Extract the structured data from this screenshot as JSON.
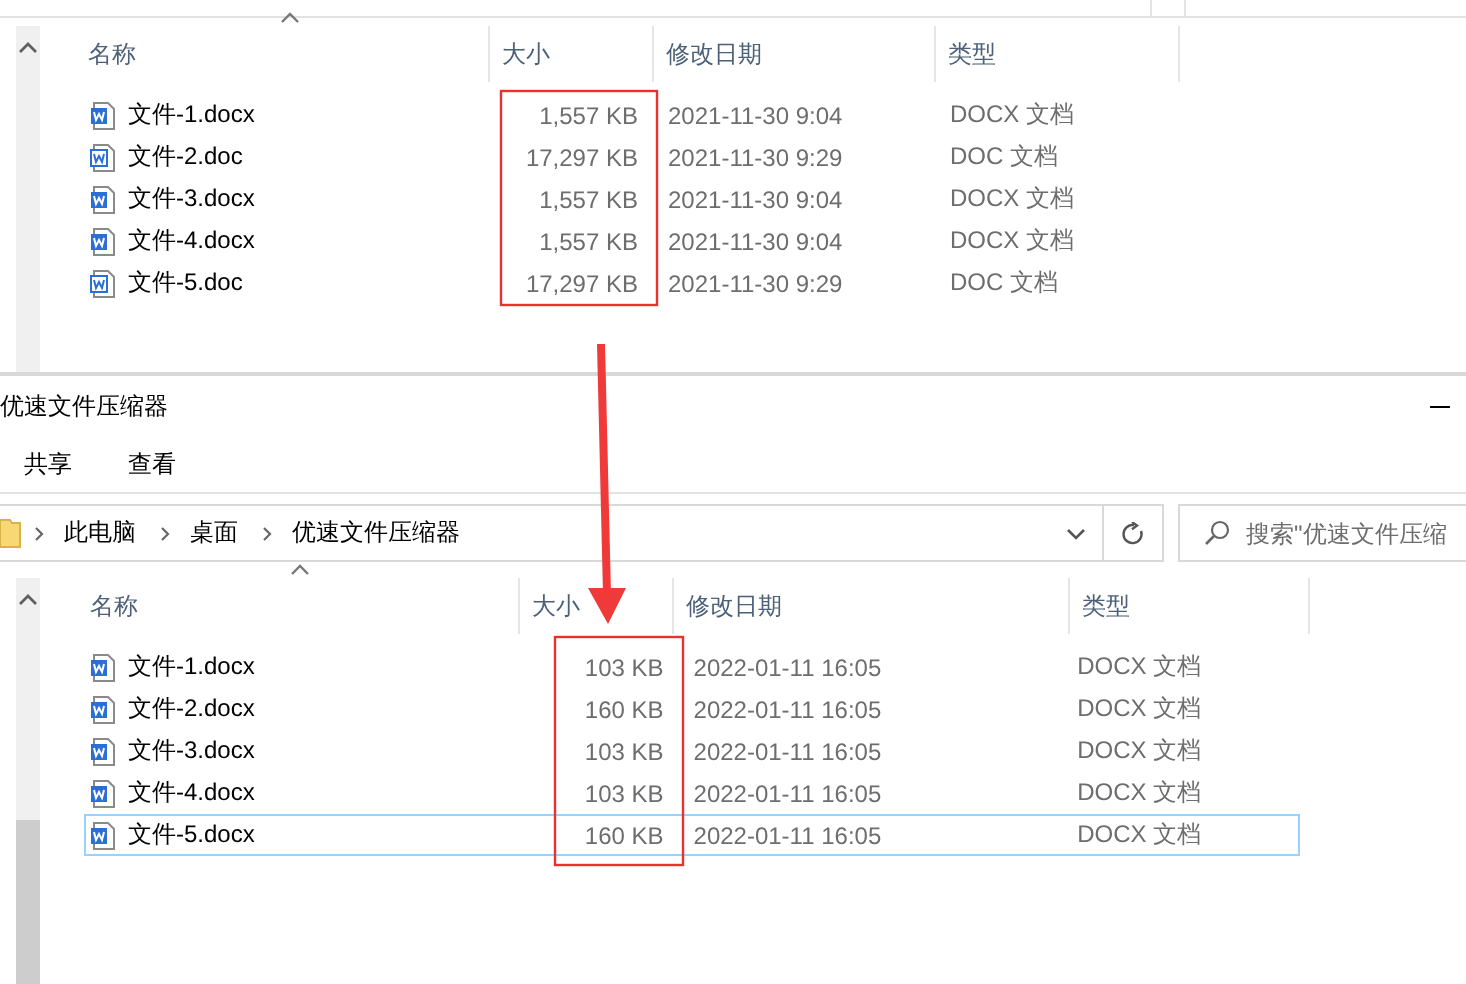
{
  "top_window": {
    "columns": [
      {
        "label": "名称",
        "sorted": true
      },
      {
        "label": "大小",
        "sorted": false
      },
      {
        "label": "修改日期",
        "sorted": false
      },
      {
        "label": "类型",
        "sorted": false
      }
    ],
    "rows": [
      {
        "kind": "docx",
        "name": "文件-1.docx",
        "size": "1,557 KB",
        "modified": "2021-11-30 9:04",
        "type": "DOCX 文档",
        "selected": false
      },
      {
        "kind": "doc",
        "name": "文件-2.doc",
        "size": "17,297 KB",
        "modified": "2021-11-30 9:29",
        "type": "DOC 文档",
        "selected": false
      },
      {
        "kind": "docx",
        "name": "文件-3.docx",
        "size": "1,557 KB",
        "modified": "2021-11-30 9:04",
        "type": "DOCX 文档",
        "selected": false
      },
      {
        "kind": "docx",
        "name": "文件-4.docx",
        "size": "1,557 KB",
        "modified": "2021-11-30 9:04",
        "type": "DOCX 文档",
        "selected": false
      },
      {
        "kind": "doc",
        "name": "文件-5.doc",
        "size": "17,297 KB",
        "modified": "2021-11-30 9:29",
        "type": "DOC 文档",
        "selected": false
      }
    ]
  },
  "bottom_window": {
    "title": "优速文件压缩器",
    "ribbon_tabs": [
      {
        "label": "共享"
      },
      {
        "label": "查看"
      }
    ],
    "address": {
      "path": [
        "此电脑",
        "桌面",
        "优速文件压缩器"
      ]
    },
    "search": {
      "placeholder": "搜索\"优速文件压缩"
    },
    "columns": [
      {
        "label": "名称",
        "sorted": true
      },
      {
        "label": "大小",
        "sorted": false
      },
      {
        "label": "修改日期",
        "sorted": false
      },
      {
        "label": "类型",
        "sorted": false
      }
    ],
    "rows": [
      {
        "kind": "docx",
        "name": "文件-1.docx",
        "size": "103 KB",
        "modified": "2022-01-11 16:05",
        "type": "DOCX 文档",
        "selected": false
      },
      {
        "kind": "docx",
        "name": "文件-2.docx",
        "size": "160 KB",
        "modified": "2022-01-11 16:05",
        "type": "DOCX 文档",
        "selected": false
      },
      {
        "kind": "docx",
        "name": "文件-3.docx",
        "size": "103 KB",
        "modified": "2022-01-11 16:05",
        "type": "DOCX 文档",
        "selected": false
      },
      {
        "kind": "docx",
        "name": "文件-4.docx",
        "size": "103 KB",
        "modified": "2022-01-11 16:05",
        "type": "DOCX 文档",
        "selected": false
      },
      {
        "kind": "docx",
        "name": "文件-5.docx",
        "size": "160 KB",
        "modified": "2022-01-11 16:05",
        "type": "DOCX 文档",
        "selected": true
      }
    ]
  }
}
